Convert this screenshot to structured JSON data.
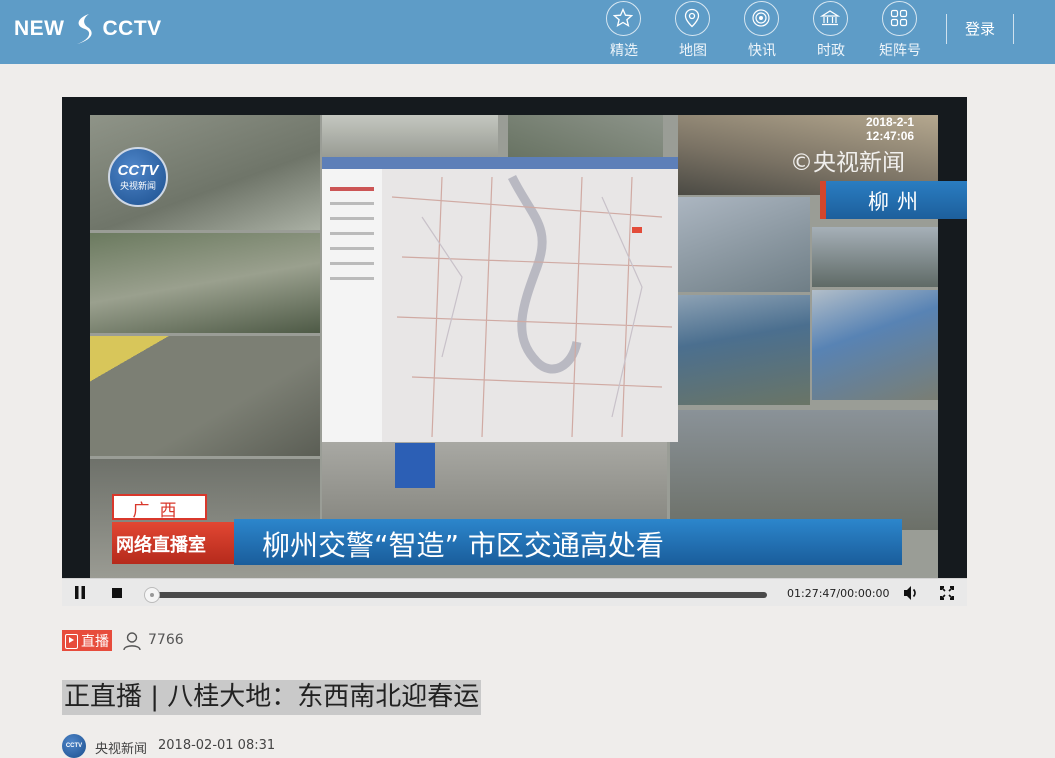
{
  "header": {
    "logo_left": "NEW",
    "logo_right": "CCTV",
    "nav": [
      {
        "label": "精选",
        "icon": "star-icon"
      },
      {
        "label": "地图",
        "icon": "map-pin-icon"
      },
      {
        "label": "快讯",
        "icon": "broadcast-icon"
      },
      {
        "label": "时政",
        "icon": "building-icon"
      },
      {
        "label": "矩阵号",
        "icon": "grid-icon"
      }
    ],
    "login": "登录"
  },
  "video": {
    "timestamp": "2018-2-1 12:47:06",
    "watermark": "©央视新闻",
    "badge_top": "CCTV",
    "badge_bottom": "央视新闻",
    "city": "柳州",
    "region": "广西",
    "program": "网络直播室",
    "headline": "柳州交警“智造”  市区交通高处看"
  },
  "player": {
    "current_time": "01:27:47",
    "duration": "00:00:00",
    "time_separator": "/",
    "progress_fraction": 0
  },
  "meta": {
    "live_label": "直播",
    "viewers": "7766"
  },
  "article": {
    "title": "正直播 | 八桂大地：东西南北迎春运",
    "author": "央视新闻",
    "date": "2018-02-01 08:31",
    "avatar_text": "CCTV"
  },
  "colors": {
    "header_bg": "#5e9cc7",
    "live_red": "#e74c3c",
    "page_bg": "#efedeb"
  }
}
